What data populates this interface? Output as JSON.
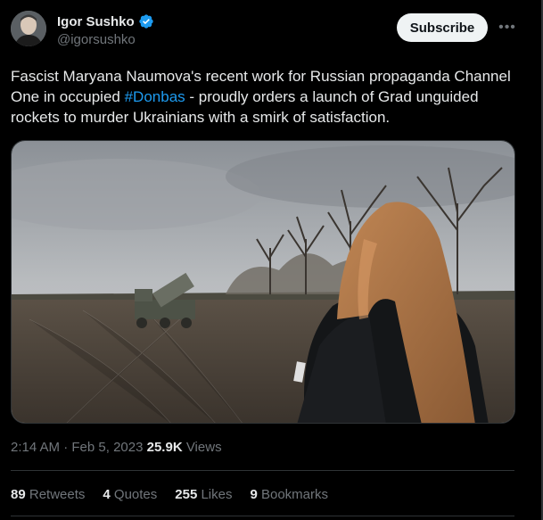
{
  "author": {
    "display_name": "Igor Sushko",
    "handle": "@igorsushko"
  },
  "subscribe_label": "Subscribe",
  "more_label": "•••",
  "tweet": {
    "text_before": "Fascist Maryana Naumova's recent work for Russian propaganda Channel One in occupied ",
    "hashtag": "#Donbas",
    "text_after": " - proudly orders a launch of Grad unguided rockets to murder Ukrainians with a smirk of satisfaction."
  },
  "meta": {
    "time": "2:14 AM",
    "separator": " · ",
    "date": "Feb 5, 2023",
    "views_count": "25.9K",
    "views_label": " Views"
  },
  "stats": [
    {
      "num": "89",
      "label": " Retweets"
    },
    {
      "num": "4",
      "label": " Quotes"
    },
    {
      "num": "255",
      "label": " Likes"
    },
    {
      "num": "9",
      "label": " Bookmarks"
    }
  ],
  "colors": {
    "background": "#000000",
    "text": "#e7e9ea",
    "secondary": "#71767b",
    "link": "#1d9bf0",
    "verified": "#1d9bf0"
  }
}
